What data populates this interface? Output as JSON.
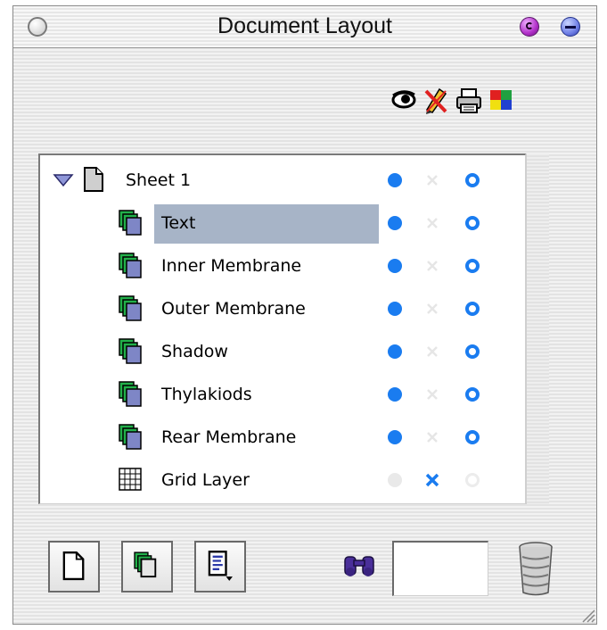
{
  "window": {
    "title": "Document Layout"
  },
  "columns": {
    "visibility_icon": "eye-icon",
    "lock_icon": "pencil-crossed-icon",
    "print_icon": "printer-icon",
    "color_icon": "color-swatch-icon"
  },
  "layers": {
    "sheet": {
      "name": "Sheet 1",
      "expanded": true
    },
    "items": [
      {
        "name": "Text",
        "selected": true,
        "visible": true,
        "locked": false,
        "printable": true
      },
      {
        "name": "Inner Membrane",
        "selected": false,
        "visible": true,
        "locked": false,
        "printable": true
      },
      {
        "name": "Outer Membrane",
        "selected": false,
        "visible": true,
        "locked": false,
        "printable": true
      },
      {
        "name": "Shadow",
        "selected": false,
        "visible": true,
        "locked": false,
        "printable": true
      },
      {
        "name": "Thylakiods",
        "selected": false,
        "visible": true,
        "locked": false,
        "printable": true
      },
      {
        "name": "Rear Membrane",
        "selected": false,
        "visible": true,
        "locked": false,
        "printable": true
      }
    ],
    "grid": {
      "name": "Grid Layer",
      "visible": false,
      "locked": true,
      "printable": false
    }
  },
  "toolbar": {
    "new_sheet_icon": "new-sheet-icon",
    "new_layer_icon": "new-layer-icon",
    "layer_options_icon": "layer-options-icon",
    "find_icon": "binoculars-icon",
    "search_value": "",
    "trash_icon": "trash-icon"
  },
  "colors": {
    "indicator_blue": "#1a7cf0",
    "selection": "#a7b4c7",
    "layer_green": "#22b04a",
    "layer_purple": "#7e86c6"
  }
}
